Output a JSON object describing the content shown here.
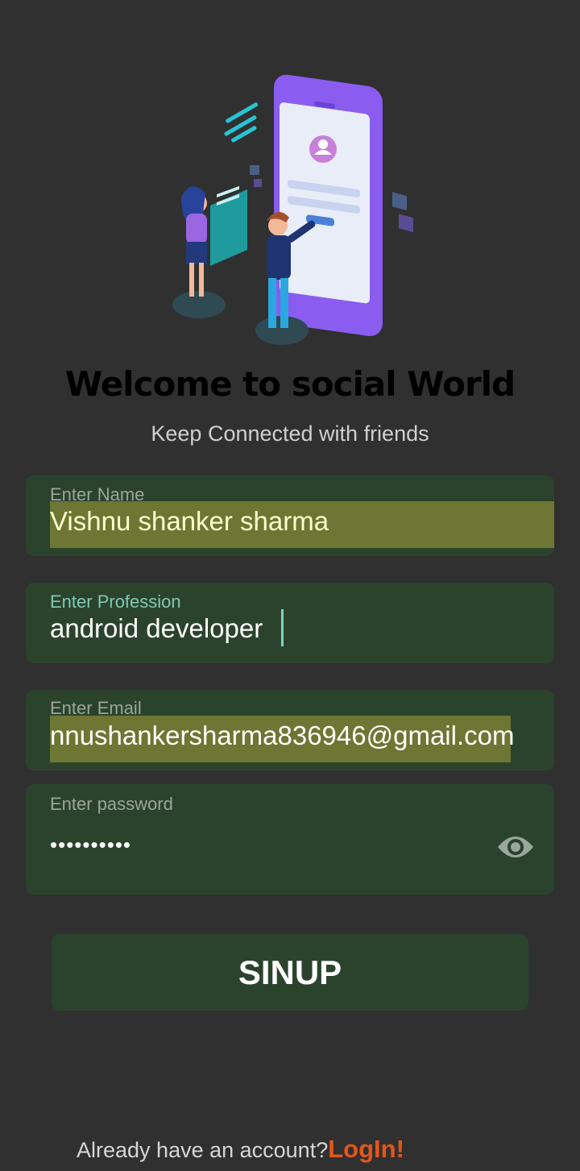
{
  "header": {
    "title": "Welcome to social World",
    "subtitle": "Keep Connected with friends"
  },
  "form": {
    "name": {
      "label": "Enter Name",
      "value": "Vishnu shanker sharma"
    },
    "profession": {
      "label": "Enter Profession",
      "value": "android developer"
    },
    "email": {
      "label": "Enter Email",
      "value": "nnushankersharma836946@gmail.com"
    },
    "password": {
      "label": "Enter password",
      "value": "••••••••••"
    }
  },
  "signup_button": {
    "label": "SINUP"
  },
  "footer": {
    "prompt": "Already have an account?",
    "link": "LogIn!"
  },
  "colors": {
    "background": "#303030",
    "field_bg": "#2b432d",
    "highlight": "#6d7632",
    "accent_link": "#e4561a",
    "focus_label": "#7fc9b5"
  },
  "icons": {
    "password_toggle": "eye-icon",
    "hero": "phone-people-illustration"
  }
}
